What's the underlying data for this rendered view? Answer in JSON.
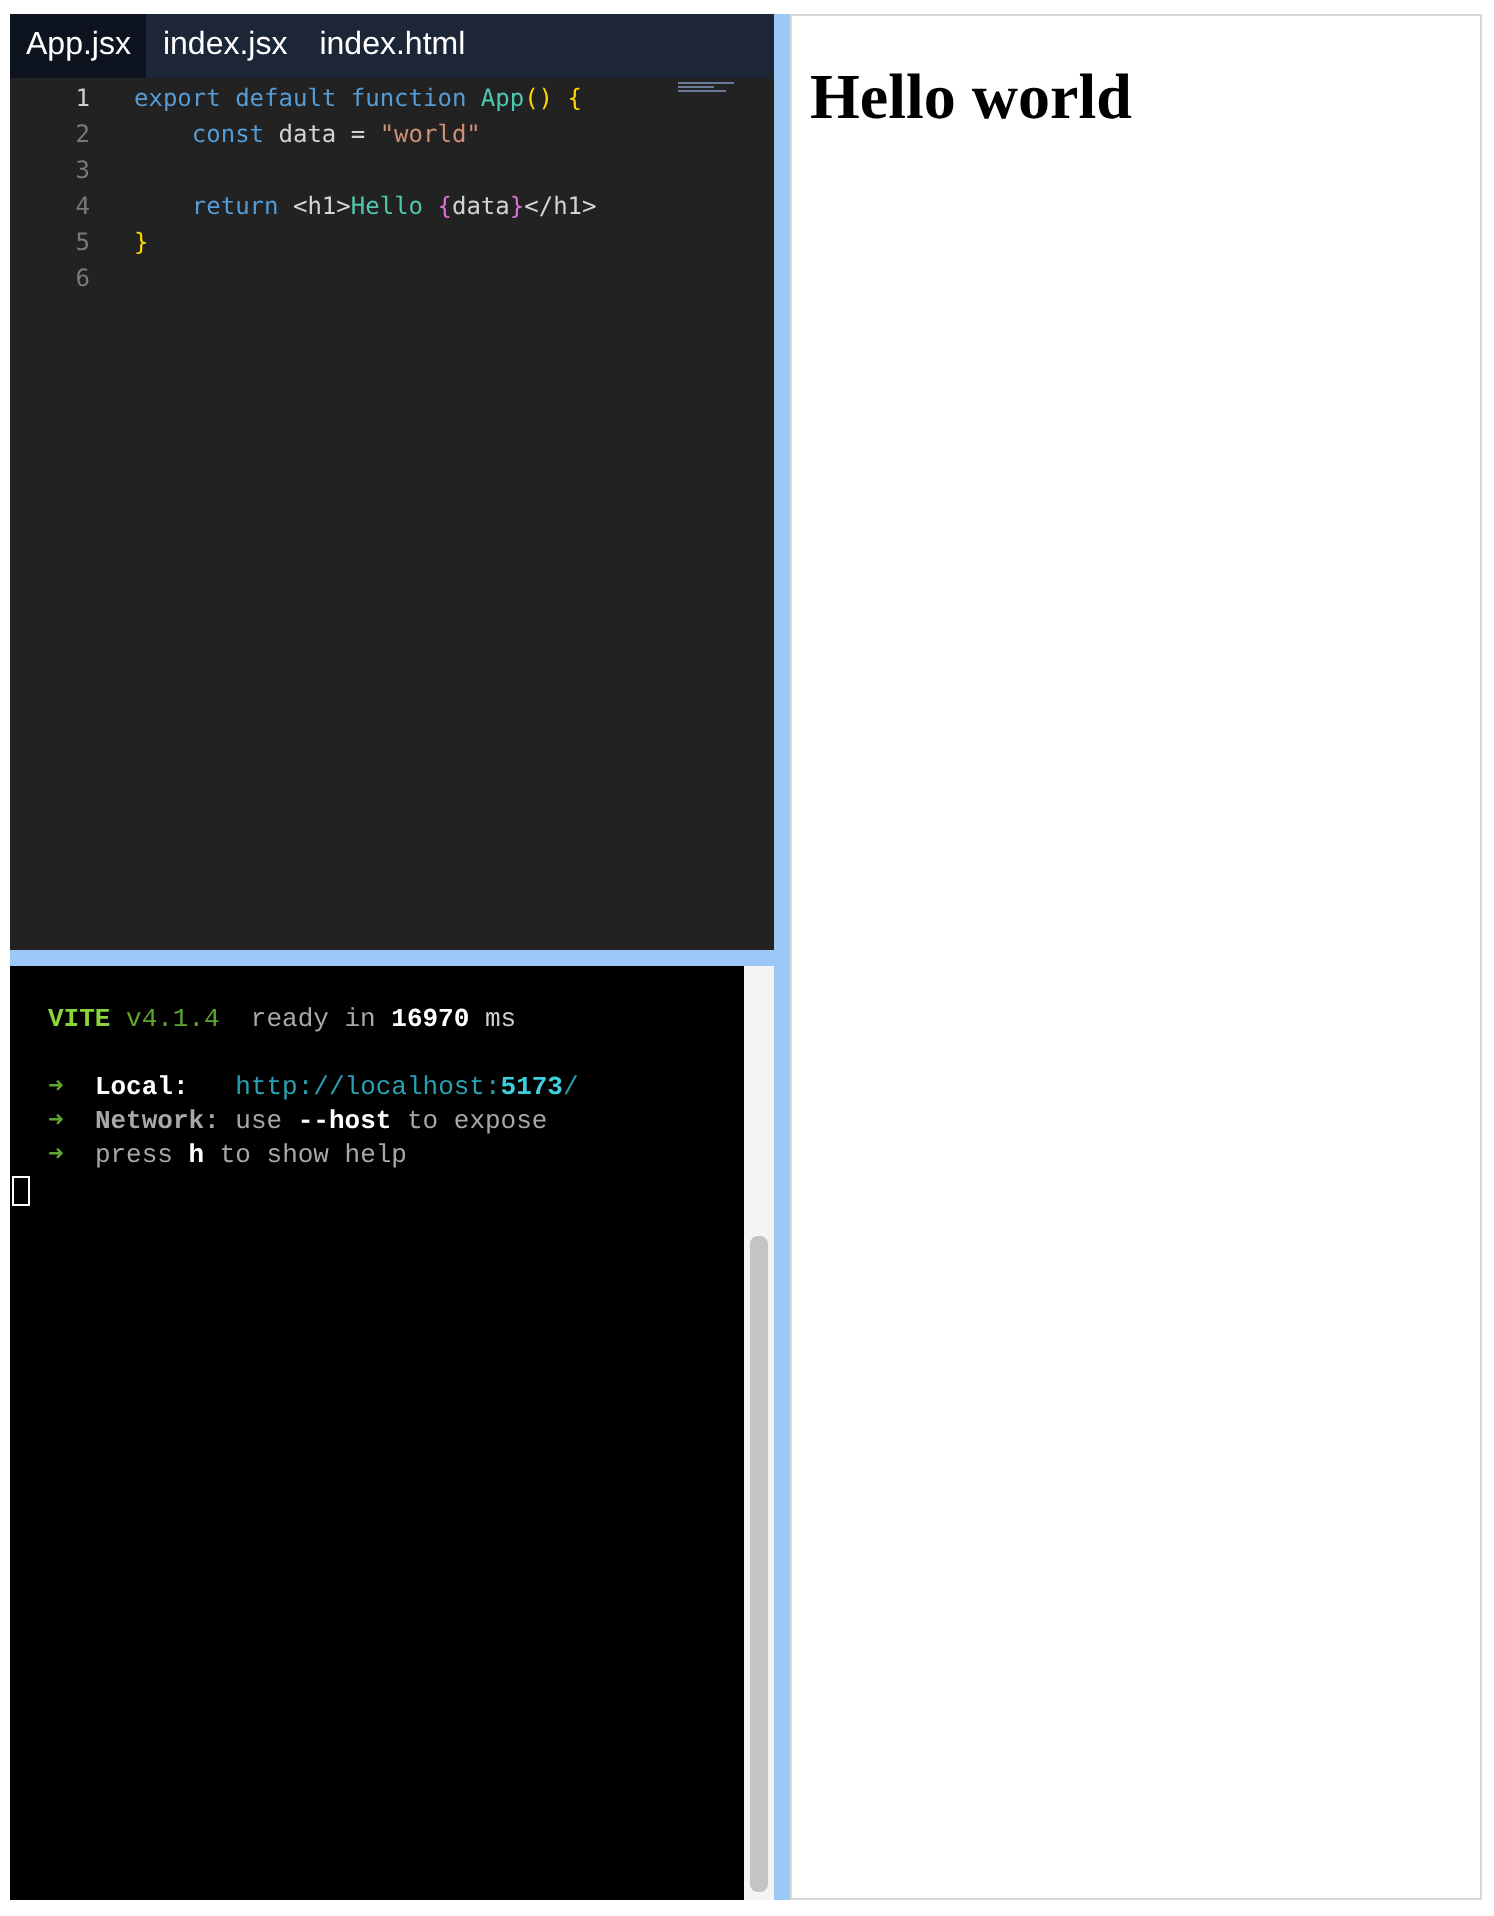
{
  "editor": {
    "tabs": [
      {
        "label": "App.jsx",
        "selected": true
      },
      {
        "label": "index.jsx",
        "selected": false
      },
      {
        "label": "index.html",
        "selected": false
      }
    ],
    "lines": [
      {
        "number": "1",
        "tokens": [
          {
            "kind": "keyword",
            "text": "export default function "
          },
          {
            "kind": "func",
            "text": "App"
          },
          {
            "kind": "bracket",
            "text": "() {"
          }
        ]
      },
      {
        "number": "2",
        "tokens": [
          {
            "kind": "keyword",
            "text": "    const "
          },
          {
            "kind": "plain",
            "text": "data = "
          },
          {
            "kind": "string",
            "text": "\"world\""
          }
        ]
      },
      {
        "number": "3"
      },
      {
        "number": "4",
        "tokens": [
          {
            "kind": "keyword",
            "text": "    return "
          },
          {
            "kind": "plain",
            "text": "<h1>"
          },
          {
            "kind": "func",
            "text": "Hello "
          },
          {
            "kind": "brace",
            "text": "{"
          },
          {
            "kind": "plain",
            "text": "data"
          },
          {
            "kind": "brace",
            "text": "}"
          },
          {
            "kind": "plain",
            "text": "</h1>"
          }
        ]
      },
      {
        "number": "5",
        "tokens": [
          {
            "kind": "bracket",
            "text": "}"
          }
        ]
      },
      {
        "number": "6"
      }
    ]
  },
  "terminal": {
    "lines": [
      {
        "kind": "header",
        "segments": [
          {
            "kind": "brand",
            "text": "VITE"
          },
          {
            "kind": "green",
            "text": " v4.1.4"
          },
          {
            "kind": "dim",
            "text": "  ready in "
          },
          {
            "kind": "bold",
            "text": "16970"
          },
          {
            "kind": "plain",
            "text": " ms"
          }
        ]
      },
      {
        "segments": [
          {
            "kind": "green",
            "text": "➜  "
          },
          {
            "kind": "bold",
            "text": "Local:"
          },
          {
            "kind": "cyan",
            "text": "   http://localhost:"
          },
          {
            "kind": "cyanbold",
            "text": "5173"
          },
          {
            "kind": "cyan",
            "text": "/"
          }
        ]
      },
      {
        "segments": [
          {
            "kind": "green",
            "text": "➜  "
          },
          {
            "kind": "dimbold",
            "text": "Network:"
          },
          {
            "kind": "dim",
            "text": " use "
          },
          {
            "kind": "bold",
            "text": "--host"
          },
          {
            "kind": "dim",
            "text": " to expose"
          }
        ]
      },
      {
        "segments": [
          {
            "kind": "green",
            "text": "➜  "
          },
          {
            "kind": "dim",
            "text": "press "
          },
          {
            "kind": "bold",
            "text": "h"
          },
          {
            "kind": "dim",
            "text": " to show help"
          }
        ]
      }
    ]
  },
  "preview": {
    "heading": "Hello world"
  }
}
